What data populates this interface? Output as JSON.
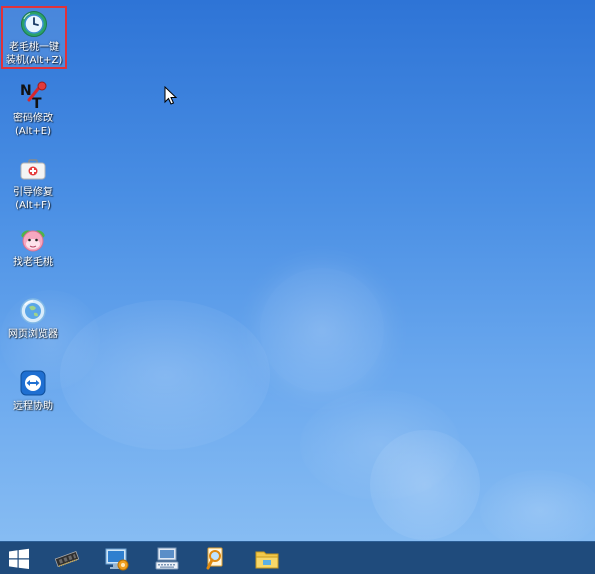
{
  "desktop": {
    "background_color": "#4a8fe4",
    "icons": [
      {
        "label_line1": "老毛桃一键",
        "label_line2": "装机(Alt+Z)",
        "icon": "restore-clock-icon",
        "selected": true
      },
      {
        "label_line1": "密码修改",
        "label_line2": "(Alt+E)",
        "icon": "nt-password-icon"
      },
      {
        "label_line1": "引导修复",
        "label_line2": "(Alt+F)",
        "icon": "first-aid-kit-icon"
      },
      {
        "label_line1": "找老毛桃",
        "icon": "peach-mascot-icon"
      },
      {
        "label_line1": "网页浏览器",
        "icon": "globe-icon"
      },
      {
        "label_line1": "远程协助",
        "icon": "teamviewer-icon"
      }
    ],
    "selection_color": "#e0323a"
  },
  "taskbar": {
    "background_color": "#1f4b7c",
    "items": [
      {
        "icon": "windows-start-icon"
      },
      {
        "icon": "memory-chip-icon"
      },
      {
        "icon": "computer-settings-icon"
      },
      {
        "icon": "keyboard-monitor-icon"
      },
      {
        "icon": "magnifier-icon"
      },
      {
        "icon": "folder-icon"
      }
    ]
  }
}
